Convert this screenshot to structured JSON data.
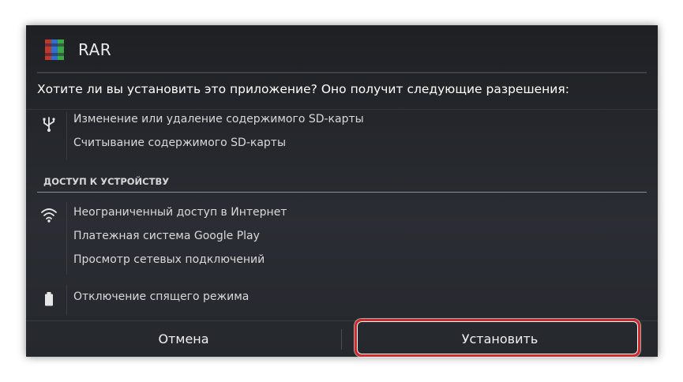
{
  "app": {
    "title": "RAR",
    "icon": "winrar-books-icon"
  },
  "question": "Хотите ли вы установить это приложение? Оно получит следующие разрешения:",
  "groups": [
    {
      "icon": "usb-icon",
      "items": [
        "Изменение или удаление содержимого SD-карты",
        "Считывание содержимого SD-карты"
      ]
    }
  ],
  "section": {
    "header": "ДОСТУП К УСТРОЙСТВУ"
  },
  "device_groups": [
    {
      "icon": "wifi-icon",
      "items": [
        "Неограниченный доступ в Интернет",
        "Платежная система Google Play",
        "Просмотр сетевых подключений"
      ]
    },
    {
      "icon": "battery-icon",
      "items": [
        "Отключение спящего режима"
      ]
    }
  ],
  "buttons": {
    "cancel": "Отмена",
    "install": "Установить"
  },
  "colors": {
    "highlight": "#d22a2a",
    "dialog_bg": "#25282d"
  }
}
